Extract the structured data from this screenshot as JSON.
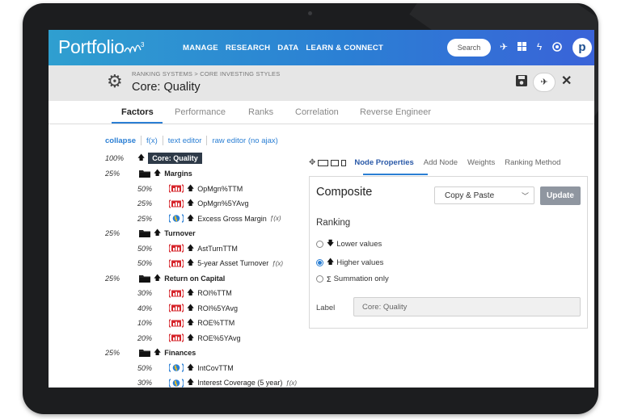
{
  "nav": {
    "logo": "Portfolio",
    "links": [
      "MANAGE",
      "RESEARCH",
      "DATA",
      "LEARN & CONNECT"
    ],
    "search_label": "Search",
    "avatar_letter": "p"
  },
  "header": {
    "breadcrumb": "RANKING SYSTEMS > CORE INVESTING STYLES",
    "title": "Core: Quality"
  },
  "tabs": [
    "Factors",
    "Performance",
    "Ranks",
    "Correlation",
    "Reverse Engineer"
  ],
  "toolbar": {
    "collapse": "collapse",
    "fx": "f(x)",
    "text_editor": "text editor",
    "raw_editor": "raw editor (no ajax)"
  },
  "tree": {
    "root": {
      "weight": "100%",
      "label": "Core: Quality"
    },
    "groups": [
      {
        "weight": "25%",
        "label": "Margins",
        "items": [
          {
            "weight": "50%",
            "label": "OpMgn%TTM",
            "icon": "bar-chart-icon",
            "fx": ""
          },
          {
            "weight": "25%",
            "label": "OpMgn%5YAvg",
            "icon": "bar-chart-icon",
            "fx": ""
          },
          {
            "weight": "25%",
            "label": "Excess Gross Margin",
            "icon": "globe-icon",
            "fx": "ƒ(x)"
          }
        ]
      },
      {
        "weight": "25%",
        "label": "Turnover",
        "items": [
          {
            "weight": "50%",
            "label": "AstTurnTTM",
            "icon": "bar-chart-icon",
            "fx": ""
          },
          {
            "weight": "50%",
            "label": "5-year Asset Turnover",
            "icon": "bar-chart-icon",
            "fx": "ƒ(x)"
          }
        ]
      },
      {
        "weight": "25%",
        "label": "Return on Capital",
        "items": [
          {
            "weight": "30%",
            "label": "ROI%TTM",
            "icon": "bar-chart-icon",
            "fx": ""
          },
          {
            "weight": "40%",
            "label": "ROI%5YAvg",
            "icon": "bar-chart-icon",
            "fx": ""
          },
          {
            "weight": "10%",
            "label": "ROE%TTM",
            "icon": "bar-chart-icon",
            "fx": ""
          },
          {
            "weight": "20%",
            "label": "ROE%5YAvg",
            "icon": "bar-chart-icon",
            "fx": ""
          }
        ]
      },
      {
        "weight": "25%",
        "label": "Finances",
        "items": [
          {
            "weight": "50%",
            "label": "IntCovTTM",
            "icon": "globe-icon",
            "fx": ""
          },
          {
            "weight": "30%",
            "label": "Interest Coverage (5 year)",
            "icon": "globe-icon",
            "fx": "ƒ(x)"
          }
        ]
      }
    ]
  },
  "panel_tabs": [
    "Node Properties",
    "Add Node",
    "Weights",
    "Ranking Method"
  ],
  "panel": {
    "heading": "Composite",
    "select_value": "Copy & Paste",
    "update_label": "Update",
    "ranking_label": "Ranking",
    "options": [
      {
        "label": "Lower values",
        "checked": false,
        "arrow": "down-arrow-icon"
      },
      {
        "label": "Higher values",
        "checked": true,
        "arrow": "up-arrow-icon"
      },
      {
        "label": "Summation only",
        "checked": false,
        "arrow": "sigma-icon"
      }
    ],
    "label_caption": "Label",
    "label_value": "Core: Quality"
  },
  "colors": {
    "nav_start": "#2f9fd0",
    "nav_end": "#3a63d8",
    "accent": "#2b7fd4",
    "factor_red": "#d6252b",
    "update_button": "#8f96a0"
  }
}
